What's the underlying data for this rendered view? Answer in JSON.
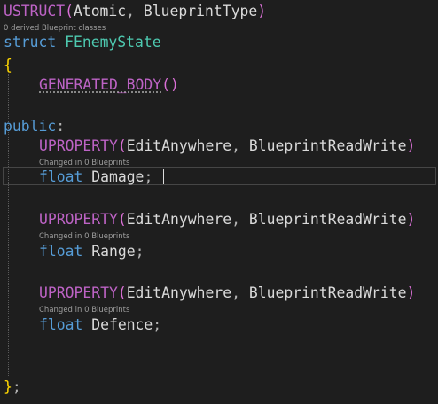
{
  "editor": {
    "lines": {
      "ustruct": {
        "macro": "USTRUCT",
        "open": "(",
        "arg1": "Atomic",
        "sep": ", ",
        "arg2": "BlueprintType",
        "close": ")"
      },
      "ustruct_hint": "0 derived Blueprint classes",
      "struct_decl": {
        "keyword": "struct",
        "name": "FEnemyState"
      },
      "open_brace": "{",
      "generated_body": {
        "macro": "GENERATED_BODY",
        "parens": "()"
      },
      "public": {
        "keyword": "public",
        "colon": ":"
      },
      "uproperty": {
        "macro": "UPROPERTY",
        "open": "(",
        "arg1": "EditAnywhere",
        "sep": ", ",
        "arg2": "BlueprintReadWrite",
        "close": ")"
      },
      "property_hint": "Changed in 0 Blueprints",
      "prop_type": "float",
      "damage": {
        "name": "Damage",
        "semi": ";"
      },
      "range": {
        "name": "Range",
        "semi": ";"
      },
      "defence": {
        "name": "Defence",
        "semi": ";"
      },
      "close_brace": "}",
      "close_semi": ";"
    },
    "colors": {
      "background": "#1e1e1e",
      "macro": "#bd63c5",
      "keyword": "#569cd6",
      "type": "#4ec9b0",
      "identifier": "#dadada"
    }
  }
}
